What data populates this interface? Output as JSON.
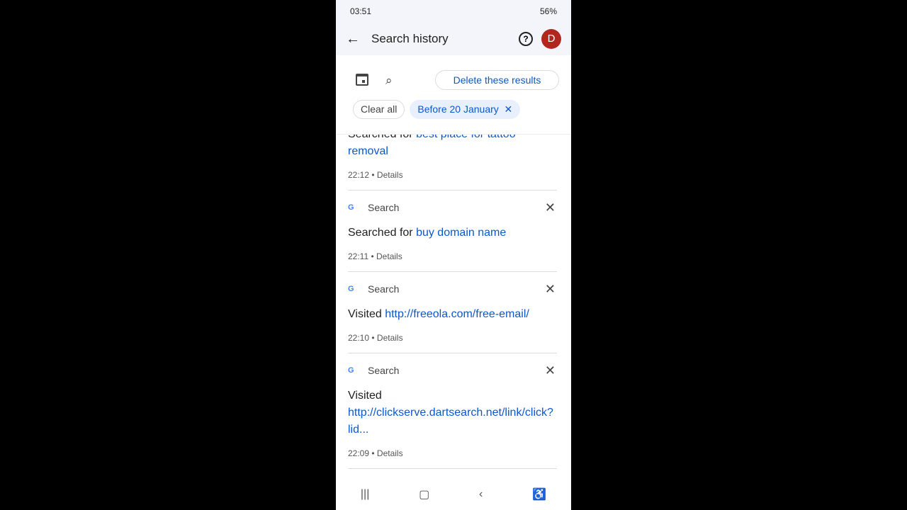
{
  "status": {
    "time": "03:51",
    "battery": "56%"
  },
  "header": {
    "title": "Search history",
    "avatar": "D"
  },
  "toolbar": {
    "delete_label": "Delete these results"
  },
  "chips": {
    "clear": "Clear all",
    "filter": "Before 20 January"
  },
  "first": {
    "prefix": "Searched for",
    "link": "best place for tattoo removal",
    "time": "22:12",
    "details": "Details"
  },
  "items": [
    {
      "source": "Search",
      "prefix": "Searched for",
      "link": "buy domain name",
      "time": "22:11",
      "details": "Details"
    },
    {
      "source": "Search",
      "prefix": "Visited",
      "link": "http://freeola.com/free-email/",
      "time": "22:10",
      "details": "Details"
    },
    {
      "source": "Search",
      "prefix": "Visited",
      "link": "http://clickserve.dartsearch.net/link/click?lid...",
      "time": "22:09",
      "details": "Details"
    }
  ],
  "colors": {
    "accent": "#0b57d0",
    "avatar": "#b3261e"
  }
}
